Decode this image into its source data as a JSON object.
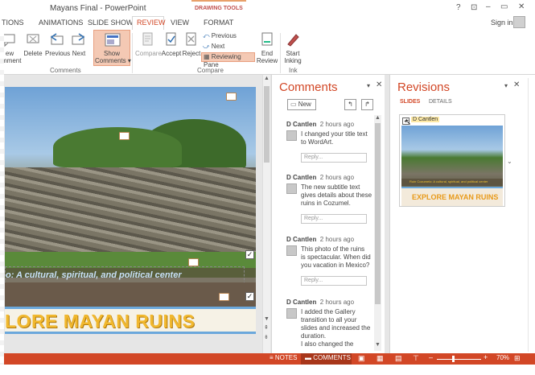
{
  "title": "Mayans Final - PowerPoint",
  "drawing_tools_label": "DRAWING TOOLS",
  "window_controls": {
    "help": "?",
    "restore": "⊡",
    "minimize": "–",
    "maximize": "▭",
    "close": "✕"
  },
  "sign_in": "Sign in",
  "tabs": [
    "TIONS",
    "ANIMATIONS",
    "SLIDE SHOW",
    "REVIEW",
    "VIEW",
    "FORMAT"
  ],
  "active_tab": "REVIEW",
  "ribbon": {
    "new_comment": [
      "ew",
      "mment"
    ],
    "delete": "Delete",
    "previous": "Previous",
    "next": "Next",
    "show_comments": [
      "Show",
      "Comments ▾"
    ],
    "comments_group": "Comments",
    "compare": "Compare",
    "accept": "Accept",
    "reject": "Reject",
    "prev_small": "Previous",
    "next_small": "Next",
    "reviewing_pane": "Reviewing Pane",
    "end_review": [
      "End",
      "Review"
    ],
    "compare_group": "Compare",
    "start_inking": [
      "Start",
      "Inking"
    ],
    "ink_group": "Ink"
  },
  "slide": {
    "subtitle": "o: A cultural, spiritual, and political center",
    "title": "LORE MAYAN RUINS"
  },
  "comments_pane": {
    "title": "Comments",
    "new_label": "New",
    "items": [
      {
        "author": "D Cantlen",
        "time": "2 hours ago",
        "lines": [
          "I changed your title text",
          "to WordArt."
        ],
        "reply": "Reply..."
      },
      {
        "author": "D Cantlen",
        "time": "2 hours ago",
        "lines": [
          "The new subtitle text",
          "gives details about these",
          "ruins in Cozumel."
        ],
        "reply": "Reply..."
      },
      {
        "author": "D Cantlen",
        "time": "2 hours ago",
        "lines": [
          "This photo of the ruins",
          "is spectacular. When did",
          "you vacation in Mexico?"
        ],
        "reply": "Reply..."
      },
      {
        "author": "D Cantlen",
        "time": "2 hours ago",
        "lines": [
          "I added the Gallery",
          "transition to all your",
          "slides and increased the",
          "duration.",
          "I also changed the"
        ],
        "reply": ""
      }
    ]
  },
  "revisions_pane": {
    "title": "Revisions",
    "tab_slides": "SLIDES",
    "tab_details": "DETAILS",
    "author_tag": "D Cantlen",
    "thumb_subtitle": "Ruin Cozumelo: A cultural, spiritual, and political center",
    "thumb_title": "EXPLORE MAYAN RUINS"
  },
  "status": {
    "notes": "NOTES",
    "comments": "COMMENTS",
    "zoom": "70%"
  }
}
